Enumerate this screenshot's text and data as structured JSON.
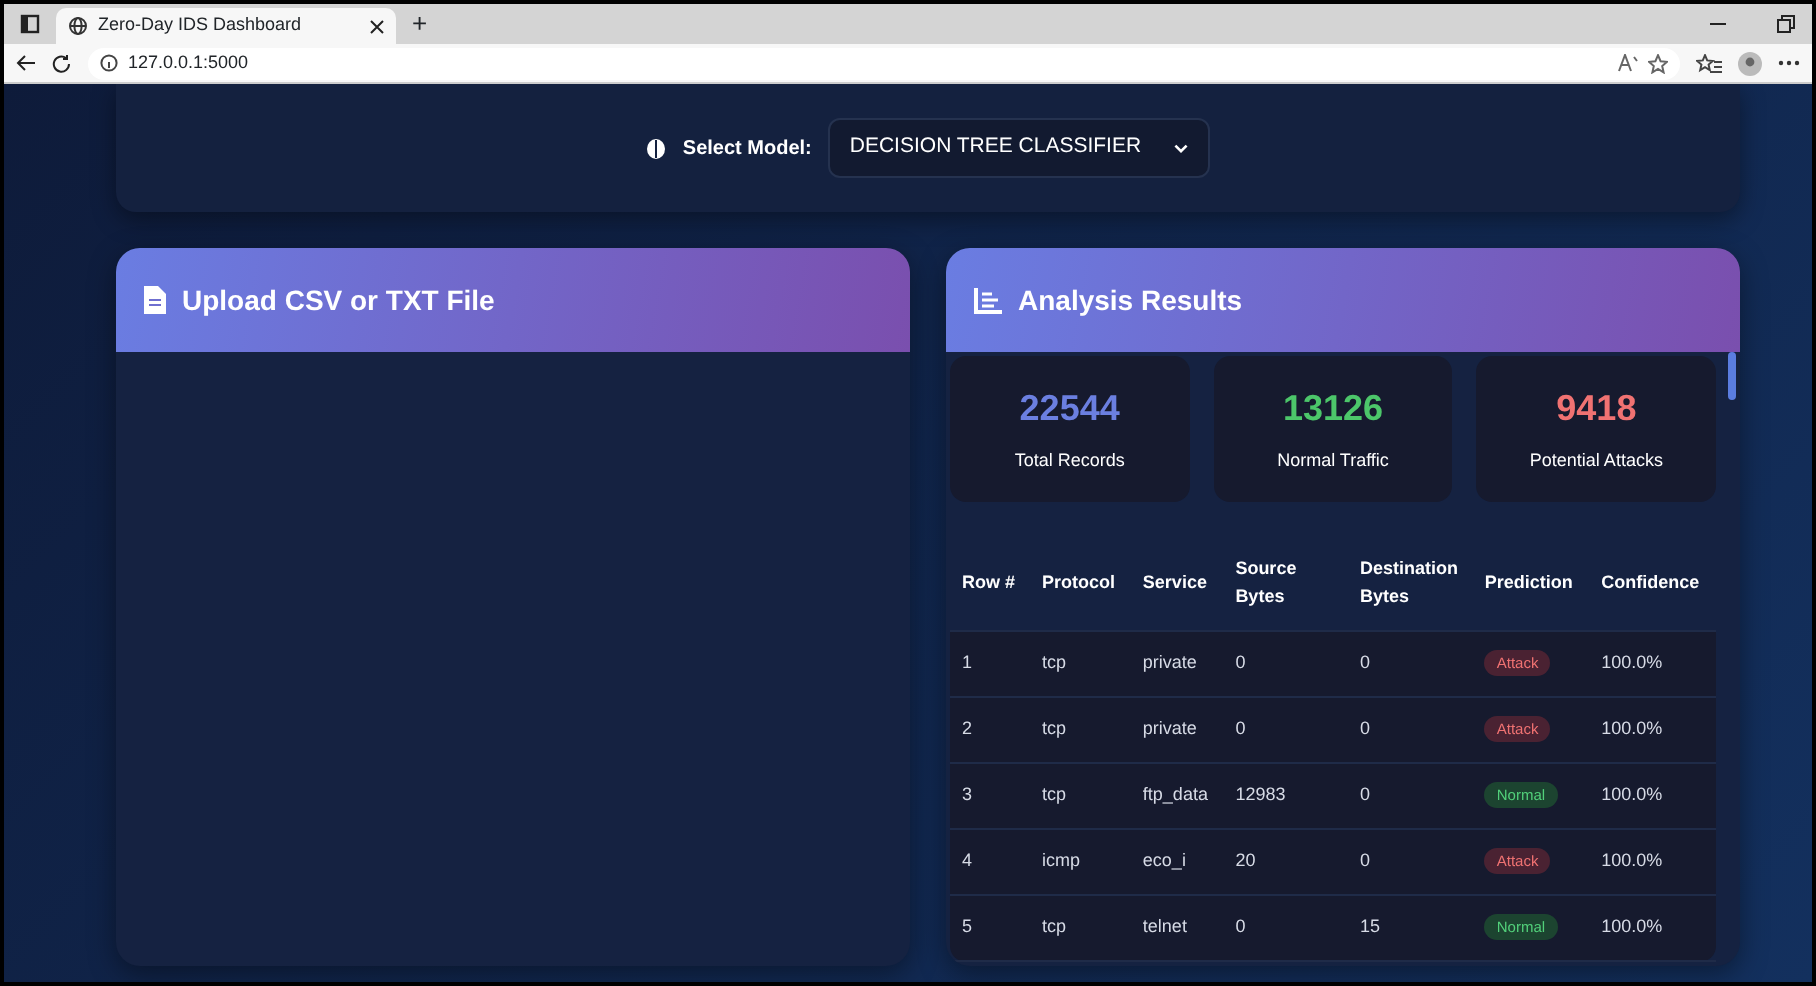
{
  "browser": {
    "tab_title": "Zero-Day IDS Dashboard",
    "new_tab": "+",
    "address": "127.0.0.1:5000"
  },
  "model_select": {
    "label": "Select Model:",
    "value": "DECISION TREE CLASSIFIER"
  },
  "upload_card": {
    "title": "Upload CSV or TXT File"
  },
  "results_card": {
    "title": "Analysis Results",
    "stats": [
      {
        "value": "22544",
        "label": "Total Records",
        "color": "#6b7fe0"
      },
      {
        "value": "13126",
        "label": "Normal Traffic",
        "color": "#4cc66a"
      },
      {
        "value": "9418",
        "label": "Potential Attacks",
        "color": "#f07272"
      }
    ],
    "table": {
      "columns": [
        "Row #",
        "Protocol",
        "Service",
        "Source Bytes",
        "Destination Bytes",
        "Prediction",
        "Confidence"
      ],
      "rows": [
        {
          "cells": [
            "1",
            "tcp",
            "private",
            "0",
            "0"
          ],
          "prediction": "Attack",
          "kind": "attack",
          "confidence": "100.0%"
        },
        {
          "cells": [
            "2",
            "tcp",
            "private",
            "0",
            "0"
          ],
          "prediction": "Attack",
          "kind": "attack",
          "confidence": "100.0%"
        },
        {
          "cells": [
            "3",
            "tcp",
            "ftp_data",
            "12983",
            "0"
          ],
          "prediction": "Normal",
          "kind": "normal",
          "confidence": "100.0%"
        },
        {
          "cells": [
            "4",
            "icmp",
            "eco_i",
            "20",
            "0"
          ],
          "prediction": "Attack",
          "kind": "attack",
          "confidence": "100.0%"
        },
        {
          "cells": [
            "5",
            "tcp",
            "telnet",
            "0",
            "15"
          ],
          "prediction": "Normal",
          "kind": "normal",
          "confidence": "100.0%"
        }
      ]
    }
  }
}
